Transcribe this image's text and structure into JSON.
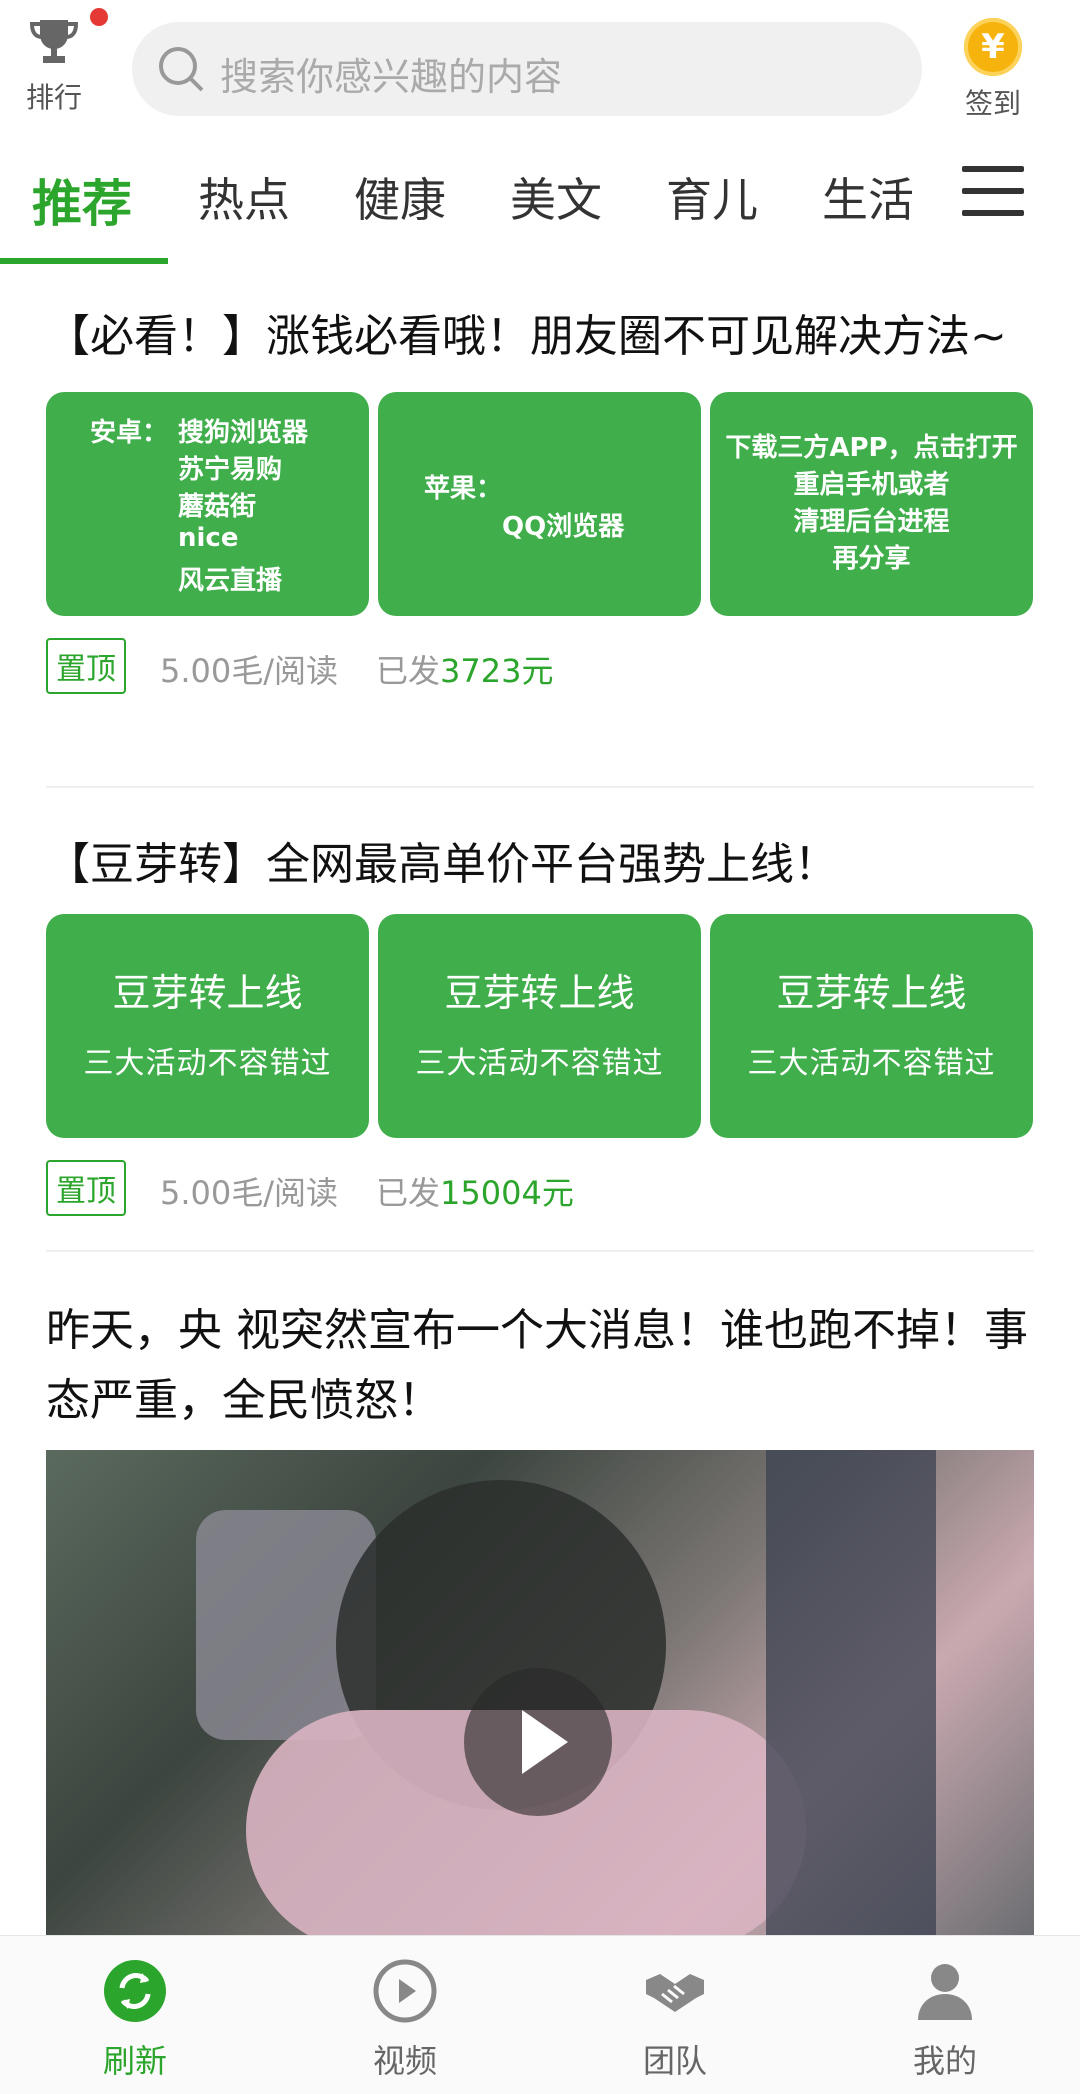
{
  "header": {
    "rank_label": "排行",
    "search_placeholder": "搜索你感兴趣的内容",
    "sign_label": "签到",
    "coin_symbol": "¥"
  },
  "tabs": [
    {
      "label": "推荐",
      "active": true
    },
    {
      "label": "热点"
    },
    {
      "label": "健康"
    },
    {
      "label": "美文"
    },
    {
      "label": "育儿"
    },
    {
      "label": "生活"
    }
  ],
  "articles": [
    {
      "title": "【必看！】涨钱必看哦！朋友圈不可见解决方法~",
      "thumbs": {
        "t1": {
          "prefix": "安卓：",
          "items": [
            "搜狗浏览器",
            "苏宁易购",
            "蘑菇街",
            "nice",
            "风云直播"
          ]
        },
        "t2": {
          "line1": "苹果：",
          "line2": "QQ浏览器"
        },
        "t3": {
          "line1": "下载三方APP，点击打开",
          "line2": "重启手机或者",
          "line3": "清理后台进程",
          "line4": "再分享"
        }
      },
      "badge": "置顶",
      "price": "5.00毛/阅读",
      "sent_prefix": "已发",
      "sent_amount": "3723元"
    },
    {
      "title": "【豆芽转】全网最高单价平台强势上线！",
      "thumb_big": "豆芽转上线",
      "thumb_small": "三大活动不容错过",
      "badge": "置顶",
      "price": "5.00毛/阅读",
      "sent_prefix": "已发",
      "sent_amount": "15004元"
    },
    {
      "title": "昨天，央 视突然宣布一个大消息！谁也跑不掉！事态严重，全民愤怒！"
    }
  ],
  "bottom_nav": [
    {
      "label": "刷新",
      "icon": "refresh-icon",
      "active": true
    },
    {
      "label": "视频",
      "icon": "play-circle-icon"
    },
    {
      "label": "团队",
      "icon": "handshake-icon"
    },
    {
      "label": "我的",
      "icon": "user-icon"
    }
  ],
  "colors": {
    "accent": "#2ca52c",
    "thumb_green": "#3fae4b",
    "badge_dot": "#e53935",
    "coin": "#f6b30d"
  }
}
